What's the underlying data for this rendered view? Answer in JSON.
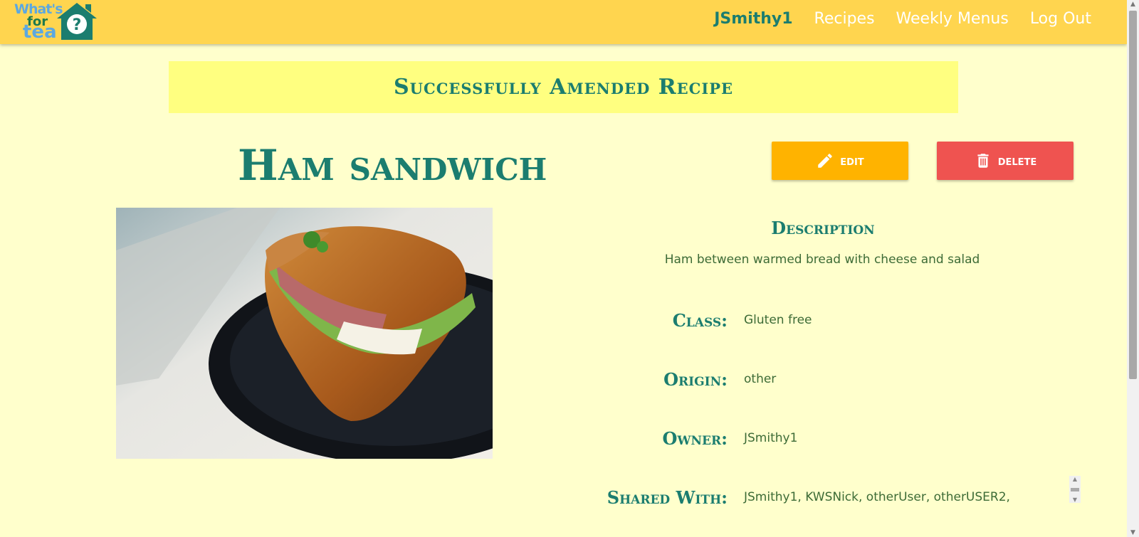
{
  "app": {
    "logo": {
      "line1": "What's",
      "line2": "for",
      "line3": "tea"
    }
  },
  "nav": {
    "username": "JSmithy1",
    "recipes": "Recipes",
    "weekly_menus": "Weekly Menus",
    "logout": "Log Out"
  },
  "flash": {
    "message": "Successfully Amended Recipe"
  },
  "recipe": {
    "title": "Ham sandwich",
    "edit_label": "edit",
    "delete_label": "delete",
    "description_heading": "Description",
    "description": "Ham between warmed bread with cheese and salad",
    "fields": [
      {
        "label": "Class:",
        "value": "Gluten free"
      },
      {
        "label": "Origin:",
        "value": "other"
      },
      {
        "label": "Owner:",
        "value": "JSmithy1"
      },
      {
        "label": "Shared With:",
        "value": "JSmithy1, KWSNick, otherUser, otherUSER2,"
      }
    ]
  },
  "icons": {
    "edit": "pencil-icon",
    "delete": "trash-icon"
  },
  "colors": {
    "navbar": "#ffd54f",
    "background": "#ffffcc",
    "flash": "#ffff80",
    "heading": "#1b7d6f",
    "text": "#3d6b36",
    "edit_button": "#ffb300",
    "delete_button": "#ef5350"
  }
}
